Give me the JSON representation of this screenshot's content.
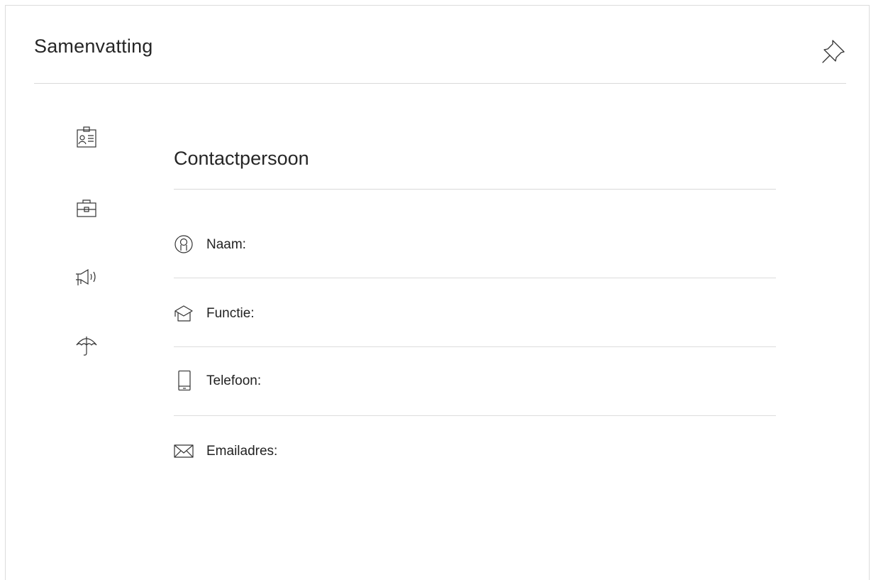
{
  "panel": {
    "title": "Samenvatting",
    "pin_icon": "pin-icon"
  },
  "side_nav": {
    "items": [
      {
        "icon": "id-card-icon"
      },
      {
        "icon": "briefcase-icon"
      },
      {
        "icon": "megaphone-icon"
      },
      {
        "icon": "umbrella-icon"
      }
    ]
  },
  "contact": {
    "title": "Contactpersoon",
    "fields": [
      {
        "icon": "user-icon",
        "label": "Naam:"
      },
      {
        "icon": "graduation-cap-icon",
        "label": "Functie:"
      },
      {
        "icon": "mobile-phone-icon",
        "label": "Telefoon:"
      },
      {
        "icon": "envelope-icon",
        "label": "Emailadres:"
      }
    ]
  }
}
